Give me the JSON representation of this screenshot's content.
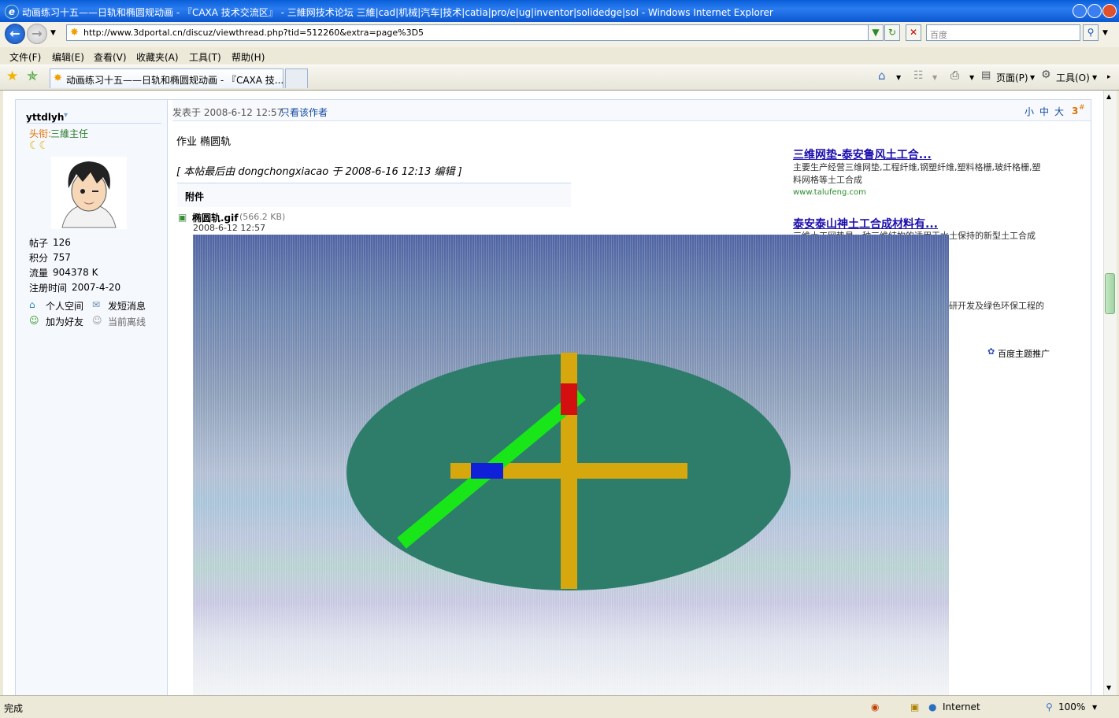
{
  "window": {
    "title": "动画练习十五——日轨和椭圆规动画 - 『CAXA 技术交流区』 - 三維网技术论坛 三維|cad|机械|汽车|技术|catia|pro/e|ug|inventor|solidedge|sol - Windows Internet Explorer"
  },
  "address_bar": {
    "url": "http://www.3dportal.cn/discuz/viewthread.php?tid=512260&extra=page%3D5",
    "search_placeholder": "百度"
  },
  "menu": [
    "文件(F)",
    "编辑(E)",
    "查看(V)",
    "收藏夹(A)",
    "工具(T)",
    "帮助(H)"
  ],
  "tabs": [
    {
      "label": "动画练习十五——日轨和椭圆规动画 - 『CAXA 技..."
    }
  ],
  "command_bar": {
    "page": "页面(P)",
    "tools": "工具(O)"
  },
  "user": {
    "name": "yttdlyh",
    "title_label": "头衔:",
    "title_value": "三維主任",
    "stats": [
      {
        "label": "帖子",
        "value": "126"
      },
      {
        "label": "积分",
        "value": "757"
      },
      {
        "label": "流量",
        "value": "904378 K"
      },
      {
        "label": "注册时间",
        "value": "2007-4-20"
      }
    ],
    "actions": [
      "个人空间",
      "发短消息",
      "加为好友",
      "当前离线"
    ]
  },
  "post": {
    "meta": "发表于 2008-6-12 12:57",
    "only_author": "只看该作者",
    "font_sizes": [
      "小",
      "中",
      "大"
    ],
    "floor": "3",
    "floor_mark": "#",
    "body": "作业  椭圆轨",
    "edit_note": "[ 本帖最后由 dongchongxiacao 于 2008-6-16 12:13 编辑 ]",
    "attach_header": "附件",
    "attachment": {
      "name": "椭圆轨.gif",
      "size": "(566.2 KB)",
      "date": "2008-6-12 12:57"
    }
  },
  "ads": [
    {
      "title": "三维网垫-泰安鲁风土工合...",
      "desc": "主要生产经营三维网垫,工程纤维,钢塑纤维,塑料格栅,玻纤格栅,塑料网格等土工合成",
      "url": "www.talufeng.com"
    },
    {
      "title": "泰安泰山神土工合成材料有...",
      "desc": "三维土工网垫是一种三维结构的适用于水土保持的新型土工合成",
      "tail": "研开发及绿色环保工程的"
    }
  ],
  "ad_footer": "百度主题推广",
  "status": {
    "left": "完成",
    "zone": "Internet",
    "zoom": "100%"
  }
}
